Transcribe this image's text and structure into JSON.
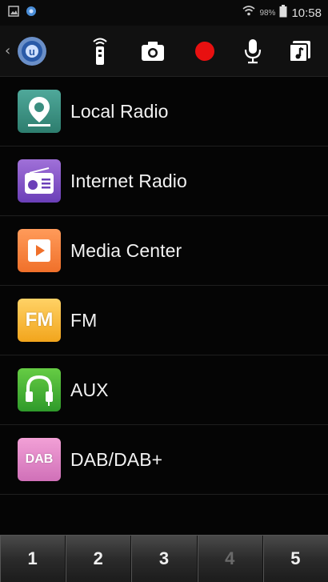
{
  "status_bar": {
    "battery_text": "98%",
    "time": "10:58"
  },
  "toolbar": {
    "items": [
      {
        "icon": "remote-icon"
      },
      {
        "icon": "camera-icon"
      },
      {
        "icon": "record-icon",
        "color": "#e81010"
      },
      {
        "icon": "microphone-icon"
      },
      {
        "icon": "music-library-icon"
      }
    ]
  },
  "menu": {
    "items": [
      {
        "label": "Local Radio",
        "icon": "map-pin-icon"
      },
      {
        "label": "Internet Radio",
        "icon": "radio-icon"
      },
      {
        "label": "Media Center",
        "icon": "play-icon"
      },
      {
        "label": "FM",
        "icon": "fm-icon",
        "icon_text": "FM"
      },
      {
        "label": "AUX",
        "icon": "headphones-icon"
      },
      {
        "label": "DAB/DAB+",
        "icon": "dab-icon",
        "icon_text": "DAB"
      }
    ]
  },
  "presets": {
    "items": [
      {
        "label": "1",
        "enabled": true
      },
      {
        "label": "2",
        "enabled": true
      },
      {
        "label": "3",
        "enabled": true
      },
      {
        "label": "4",
        "enabled": false
      },
      {
        "label": "5",
        "enabled": true
      }
    ]
  }
}
